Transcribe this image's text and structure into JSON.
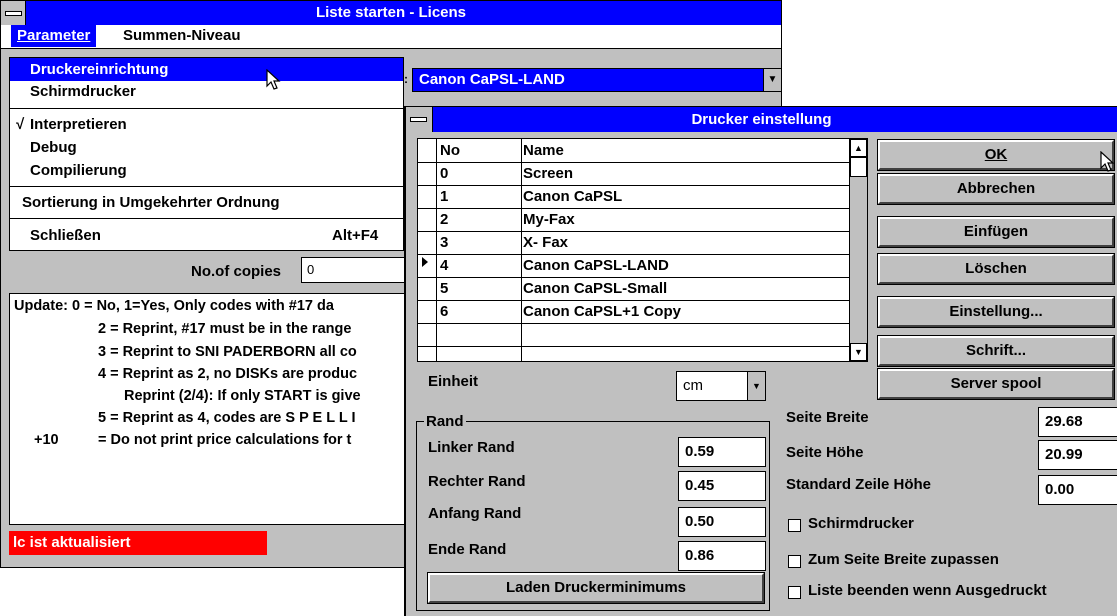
{
  "main_window": {
    "title": "Liste starten - Licens",
    "menu": {
      "parameter": "Parameter",
      "summen": "Summen-Niveau"
    },
    "dropdown": {
      "druckereinrichtung": "Druckereinrichtung",
      "schirmdrucker": "Schirmdrucker",
      "interpretieren": "Interpretieren",
      "check": "√",
      "debug": "Debug",
      "compilierung": "Compilierung",
      "sortierung": "Sortierung in Umgekehrter Ordnung",
      "schliessen": "Schließen",
      "shortcut": "Alt+F4"
    },
    "copies_label": "No.of copies",
    "copies_value": "0",
    "text_lines": [
      "Update: 0 = No, 1=Yes, Only codes with #17 da",
      "2 = Reprint, #17 must be in the range",
      "3 = Reprint to SNI PADERBORN all co",
      "4 = Reprint as 2, no DISKs are produc",
      "Reprint (2/4): If only START is give",
      "5 = Reprint as 4, codes are S P E L L I",
      "+10",
      "= Do not print price calculations for t"
    ],
    "status": "lc ist aktualisiert"
  },
  "printer_combo": {
    "value": "Canon CaPSL-LAND"
  },
  "dialog": {
    "title": "Drucker einstellung",
    "table": {
      "headers": [
        "No",
        "Name"
      ],
      "rows": [
        [
          "0",
          "Screen"
        ],
        [
          "1",
          "Canon CaPSL"
        ],
        [
          "2",
          "My-Fax"
        ],
        [
          "3",
          "X- Fax"
        ],
        [
          "4",
          "Canon CaPSL-LAND"
        ],
        [
          "5",
          "Canon CaPSL-Small"
        ],
        [
          "6",
          "Canon CaPSL+1 Copy"
        ]
      ]
    },
    "buttons": {
      "ok": "OK",
      "abbrechen": "Abbrechen",
      "einfuegen": "Einfügen",
      "loeschen": "Löschen",
      "einstellung": "Einstellung...",
      "schrift": "Schrift...",
      "server_spool": "Server spool",
      "laden": "Laden Druckerminimums"
    },
    "einheit_label": "Einheit",
    "einheit_value": "cm",
    "rand": {
      "title": "Rand",
      "linker_label": "Linker Rand",
      "linker_value": "0.59",
      "rechter_label": "Rechter Rand",
      "rechter_value": "0.45",
      "anfang_label": "Anfang Rand",
      "anfang_value": "0.50",
      "ende_label": "Ende Rand",
      "ende_value": "0.86"
    },
    "seite_breite_label": "Seite Breite",
    "seite_breite_value": "29.68",
    "seite_hoehe_label": "Seite Höhe",
    "seite_hoehe_value": "20.99",
    "zeile_label": "Standard Zeile Höhe",
    "zeile_value": "0.00",
    "checkboxes": {
      "schirmdrucker": "Schirmdrucker",
      "zupassen": "Zum Seite Breite zupassen",
      "beenden": "Liste beenden wenn Ausgedruckt"
    }
  }
}
